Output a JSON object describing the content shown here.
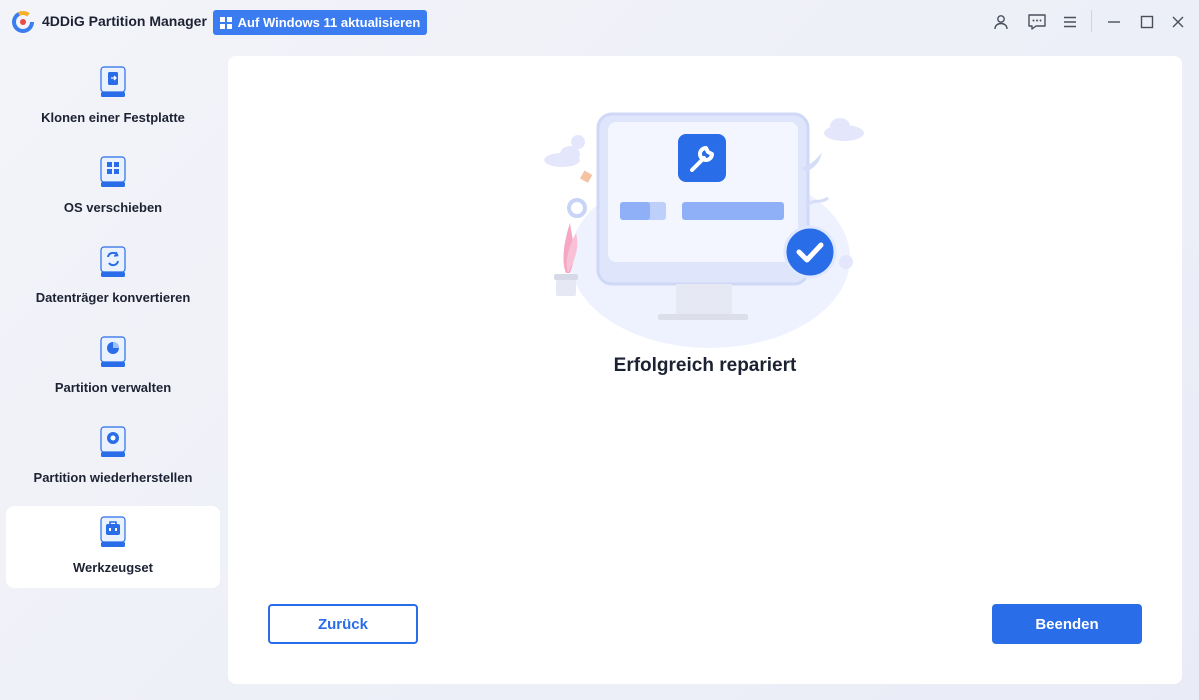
{
  "app": {
    "title": "4DDiG Partition Manager",
    "upgrade_label": "Auf Windows 11 aktualisieren",
    "accent_color": "#2a6de8"
  },
  "titlebar_icons": [
    "user-icon",
    "feedback-icon",
    "menu-icon",
    "minimize-icon",
    "maximize-icon",
    "close-icon"
  ],
  "sidebar": {
    "items": [
      {
        "label": "Klonen einer Festplatte",
        "icon": "clone-disk-icon"
      },
      {
        "label": "OS verschieben",
        "icon": "migrate-os-icon"
      },
      {
        "label": "Datenträger konvertieren",
        "icon": "convert-disk-icon"
      },
      {
        "label": "Partition verwalten",
        "icon": "manage-partition-icon"
      },
      {
        "label": "Partition wiederherstellen",
        "icon": "recover-partition-icon"
      },
      {
        "label": "Werkzeugset",
        "icon": "toolkit-icon",
        "active": true
      }
    ]
  },
  "main": {
    "status_text": "Erfolgreich repariert",
    "back_label": "Zurück",
    "finish_label": "Beenden"
  }
}
